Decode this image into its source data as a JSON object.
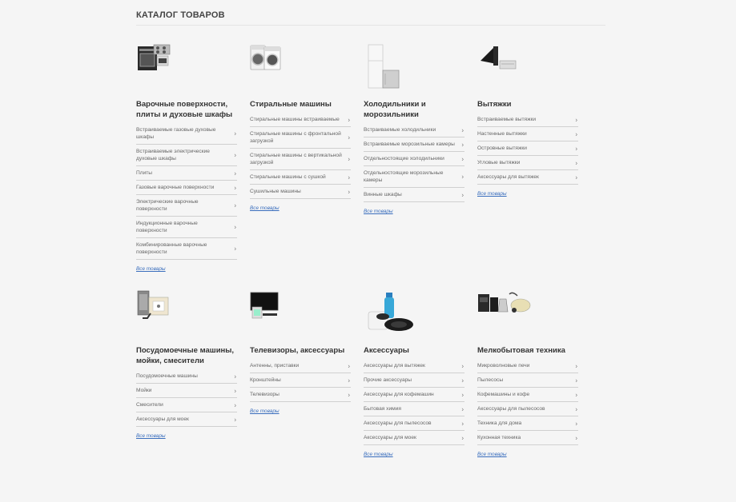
{
  "header": {
    "title": "КАТАЛОГ ТОВАРОВ"
  },
  "categories": [
    {
      "title_lines": [
        "Варочные поверхности,",
        "плиты и духовые шкафы"
      ],
      "items": [
        [
          "Встраиваемые газовые духовые",
          "шкафы"
        ],
        [
          "Встраиваемые электрические",
          "духовые шкафы"
        ],
        [
          "Плиты"
        ],
        [
          "Газовые варочные поверхности"
        ],
        [
          "Электрические варочные поверхности"
        ],
        [
          "Индукционные варочные поверхности"
        ],
        [
          "Комбинированные варочные",
          "поверхности"
        ]
      ],
      "all_link": "Все товары",
      "icon": "oven-icon"
    },
    {
      "title_lines": [
        "Стиральные машины"
      ],
      "items": [
        [
          "Стиральные машины встраиваемые"
        ],
        [
          "Стиральные машины с фронтальной",
          "загрузкой"
        ],
        [
          "Стиральные машины с вертикальной",
          "загрузкой"
        ],
        [
          "Стиральные машины с сушкой"
        ],
        [
          "Сушильные машины"
        ]
      ],
      "all_link": "Все товары",
      "icon": "washing-machine-icon"
    },
    {
      "title_lines": [
        "Холодильники и",
        "морозильники"
      ],
      "items": [
        [
          "Встраиваемые холодильники"
        ],
        [
          "Встраиваемые морозильные камеры"
        ],
        [
          "Отдельностоящие холодильники"
        ],
        [
          "Отдельностоящие морозильные",
          "камеры"
        ],
        [
          "Винные шкафы"
        ]
      ],
      "all_link": "Все товары",
      "icon": "fridge-icon"
    },
    {
      "title_lines": [
        "Вытяжки"
      ],
      "items": [
        [
          "Встраиваемые вытяжки"
        ],
        [
          "Настенные вытяжки"
        ],
        [
          "Островные вытяжки"
        ],
        [
          "Угловые вытяжки"
        ],
        [
          "Аксессуары для вытяжек"
        ]
      ],
      "all_link": "Все товары",
      "icon": "hood-icon"
    },
    {
      "title_lines": [
        "Посудомоечные машины,",
        "мойки, смесители"
      ],
      "items": [
        [
          "Посудомоечные машины"
        ],
        [
          "Мойки"
        ],
        [
          "Смесители"
        ],
        [
          "Аксессуары для моек"
        ]
      ],
      "all_link": "Все товары",
      "icon": "dishwasher-icon"
    },
    {
      "title_lines": [
        "Телевизоры, аксессуары"
      ],
      "items": [
        [
          "Антенны, приставки"
        ],
        [
          "Кронштейны"
        ],
        [
          "Телевизоры"
        ]
      ],
      "all_link": "Все товары",
      "icon": "tv-icon"
    },
    {
      "title_lines": [
        "Аксессуары"
      ],
      "items": [
        [
          "Аксессуары для вытяжек"
        ],
        [
          "Прочие аксессуары"
        ],
        [
          "Аксессуары для кофемашин"
        ],
        [
          "Бытовая химия"
        ],
        [
          "Аксессуары для пылесосов"
        ],
        [
          "Аксессуары для моек"
        ]
      ],
      "all_link": "Все товары",
      "icon": "accessories-icon"
    },
    {
      "title_lines": [
        "Мелкобытовая техника"
      ],
      "items": [
        [
          "Микроволновые печи"
        ],
        [
          "Пылесосы"
        ],
        [
          "Кофемашины и кофе"
        ],
        [
          "Аксессуары для пылесосов"
        ],
        [
          "Техника для дома"
        ],
        [
          "Кухонная техника"
        ]
      ],
      "all_link": "Все товары",
      "icon": "small-appliances-icon"
    }
  ]
}
